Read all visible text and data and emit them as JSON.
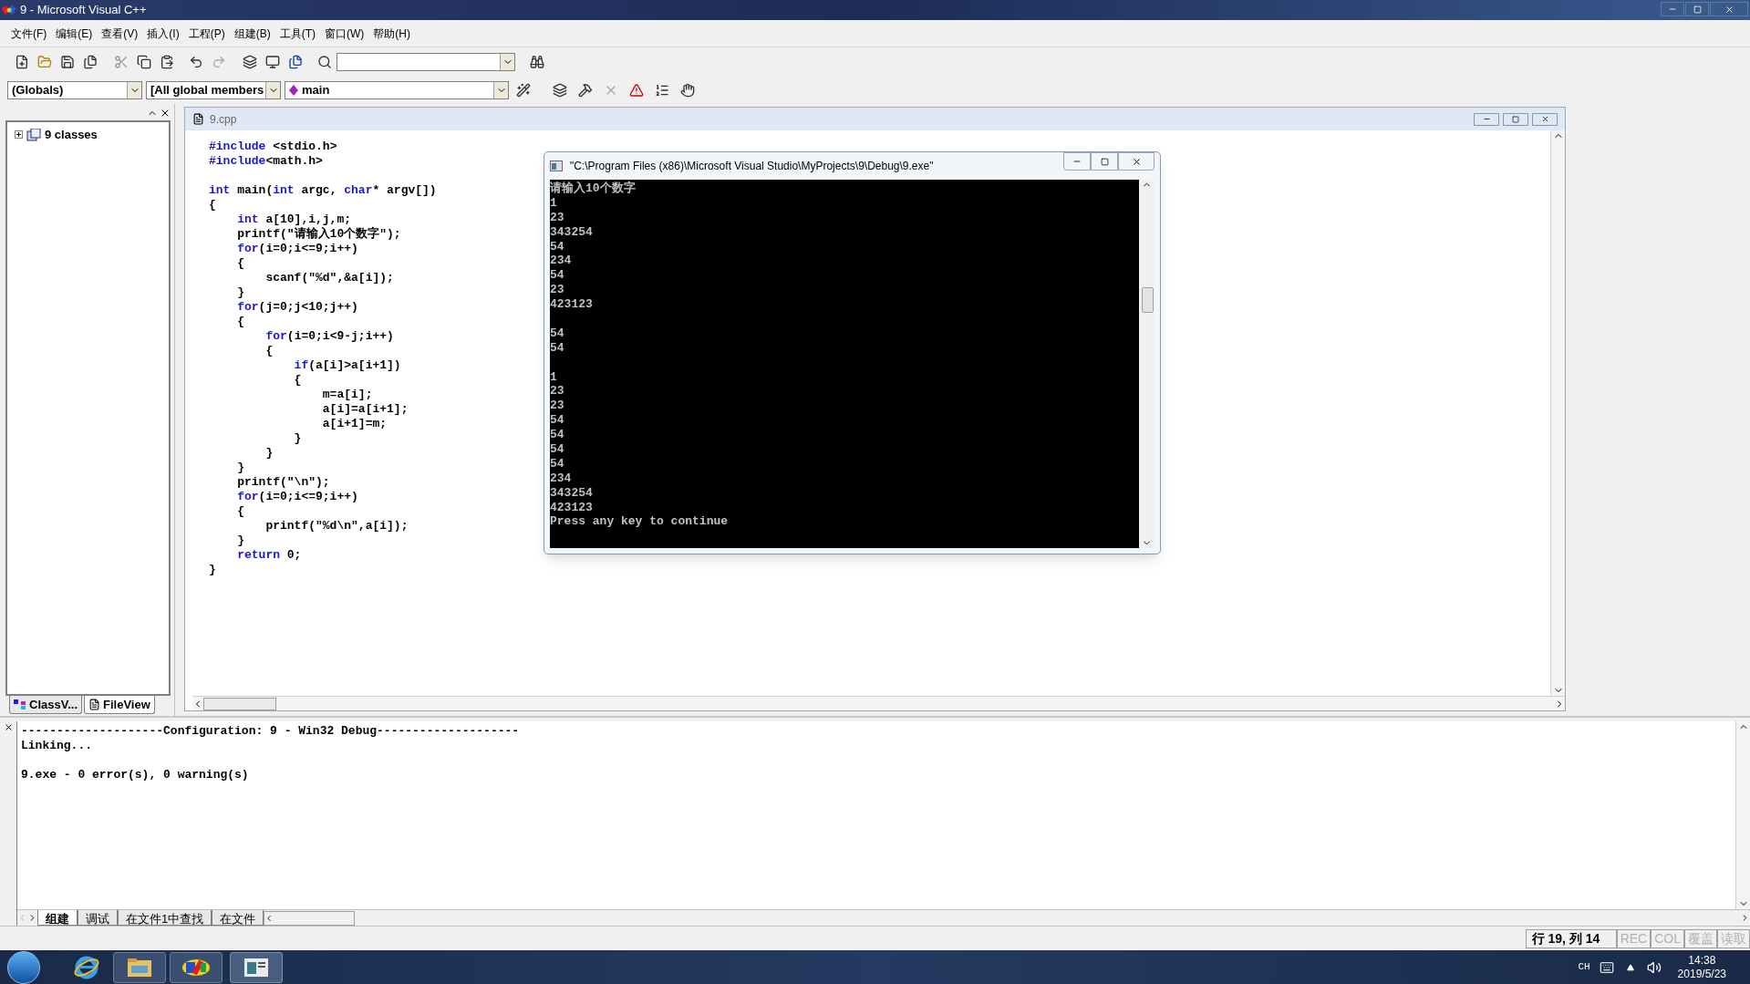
{
  "window": {
    "title": "9 - Microsoft Visual C++"
  },
  "menu": [
    {
      "label": "文件(F)"
    },
    {
      "label": "编辑(E)"
    },
    {
      "label": "查看(V)"
    },
    {
      "label": "插入(I)"
    },
    {
      "label": "工程(P)"
    },
    {
      "label": "组建(B)"
    },
    {
      "label": "工具(T)"
    },
    {
      "label": "窗口(W)"
    },
    {
      "label": "帮助(H)"
    }
  ],
  "wizard_bar": {
    "class": "(Globals)",
    "filter": "[All global members",
    "member": "main"
  },
  "workspace": {
    "tree": [
      {
        "label": "9 classes",
        "expanded": false
      }
    ],
    "tabs": [
      {
        "label": "ClassV...",
        "selected": false
      },
      {
        "label": "FileView",
        "selected": true
      }
    ]
  },
  "editor": {
    "title": "9.cpp",
    "lines": [
      {
        "kind": "code",
        "segments": [
          {
            "kind": "keyword",
            "text": "#include"
          },
          {
            "kind": "plain",
            "text": " <stdio.h>"
          }
        ]
      },
      {
        "kind": "code",
        "segments": [
          {
            "kind": "keyword",
            "text": "#include"
          },
          {
            "kind": "plain",
            "text": "<math.h>"
          }
        ]
      },
      {
        "kind": "blank"
      },
      {
        "kind": "code",
        "segments": [
          {
            "kind": "keyword",
            "text": "int"
          },
          {
            "kind": "plain",
            "text": " main("
          },
          {
            "kind": "keyword",
            "text": "int"
          },
          {
            "kind": "plain",
            "text": " argc, "
          },
          {
            "kind": "keyword",
            "text": "char"
          },
          {
            "kind": "plain",
            "text": "* argv[])"
          }
        ]
      },
      {
        "kind": "code",
        "segments": [
          {
            "kind": "plain",
            "text": "{"
          }
        ]
      },
      {
        "kind": "code",
        "segments": [
          {
            "kind": "keyword",
            "text": "    int"
          },
          {
            "kind": "plain",
            "text": " a[10],i,j,m;"
          }
        ]
      },
      {
        "kind": "code",
        "segments": [
          {
            "kind": "plain",
            "text": "    printf(\"请输入10个数字\");"
          }
        ]
      },
      {
        "kind": "code",
        "segments": [
          {
            "kind": "keyword",
            "text": "    for"
          },
          {
            "kind": "plain",
            "text": "(i=0;i<=9;i++)"
          }
        ]
      },
      {
        "kind": "code",
        "segments": [
          {
            "kind": "plain",
            "text": "    {"
          }
        ]
      },
      {
        "kind": "code",
        "segments": [
          {
            "kind": "plain",
            "text": "        scanf(\"%d\",&a[i]);"
          }
        ]
      },
      {
        "kind": "code",
        "segments": [
          {
            "kind": "plain",
            "text": "    }"
          }
        ]
      },
      {
        "kind": "code",
        "segments": [
          {
            "kind": "keyword",
            "text": "    for"
          },
          {
            "kind": "plain",
            "text": "(j=0;j<10;j++)"
          }
        ]
      },
      {
        "kind": "code",
        "segments": [
          {
            "kind": "plain",
            "text": "    {"
          }
        ]
      },
      {
        "kind": "code",
        "segments": [
          {
            "kind": "keyword",
            "text": "        for"
          },
          {
            "kind": "plain",
            "text": "(i=0;i<9-j;i++)"
          }
        ]
      },
      {
        "kind": "code",
        "segments": [
          {
            "kind": "plain",
            "text": "        {"
          }
        ]
      },
      {
        "kind": "code",
        "segments": [
          {
            "kind": "keyword",
            "text": "            if"
          },
          {
            "kind": "plain",
            "text": "(a[i]>a[i+1])"
          }
        ]
      },
      {
        "kind": "code",
        "segments": [
          {
            "kind": "plain",
            "text": "            {"
          }
        ]
      },
      {
        "kind": "code",
        "segments": [
          {
            "kind": "plain",
            "text": "                m=a[i];"
          }
        ]
      },
      {
        "kind": "code",
        "segments": [
          {
            "kind": "plain",
            "text": "                a[i]=a[i+1];"
          }
        ]
      },
      {
        "kind": "code",
        "segments": [
          {
            "kind": "plain",
            "text": "                a[i+1]=m;"
          }
        ]
      },
      {
        "kind": "code",
        "segments": [
          {
            "kind": "plain",
            "text": "            }"
          }
        ]
      },
      {
        "kind": "code",
        "segments": [
          {
            "kind": "plain",
            "text": "        }"
          }
        ]
      },
      {
        "kind": "code",
        "segments": [
          {
            "kind": "plain",
            "text": "    }"
          }
        ]
      },
      {
        "kind": "code",
        "segments": [
          {
            "kind": "plain",
            "text": "    printf(\"\\n\");"
          }
        ]
      },
      {
        "kind": "code",
        "segments": [
          {
            "kind": "keyword",
            "text": "    for"
          },
          {
            "kind": "plain",
            "text": "(i=0;i<=9;i++)"
          }
        ]
      },
      {
        "kind": "code",
        "segments": [
          {
            "kind": "plain",
            "text": "    {"
          }
        ]
      },
      {
        "kind": "code",
        "segments": [
          {
            "kind": "plain",
            "text": "        printf(\"%d\\n\",a[i]);"
          }
        ]
      },
      {
        "kind": "code",
        "segments": [
          {
            "kind": "plain",
            "text": "    }"
          }
        ]
      },
      {
        "kind": "code",
        "segments": [
          {
            "kind": "keyword",
            "text": "    return"
          },
          {
            "kind": "plain",
            "text": " 0;"
          }
        ]
      },
      {
        "kind": "code",
        "segments": [
          {
            "kind": "plain",
            "text": "}"
          }
        ]
      }
    ]
  },
  "console": {
    "title": "\"C:\\Program Files (x86)\\Microsoft Visual Studio\\MyProjects\\9\\Debug\\9.exe\"",
    "lines": [
      {
        "kind": "text",
        "text": "请输入10个数字"
      },
      {
        "kind": "text",
        "text": "1"
      },
      {
        "kind": "text",
        "text": "23"
      },
      {
        "kind": "text",
        "text": "343254"
      },
      {
        "kind": "text",
        "text": "54"
      },
      {
        "kind": "text",
        "text": "234"
      },
      {
        "kind": "text",
        "text": "54"
      },
      {
        "kind": "text",
        "text": "23"
      },
      {
        "kind": "text",
        "text": "423123"
      },
      {
        "kind": "blank"
      },
      {
        "kind": "text",
        "text": "54"
      },
      {
        "kind": "text",
        "text": "54"
      },
      {
        "kind": "blank"
      },
      {
        "kind": "text",
        "text": "1"
      },
      {
        "kind": "text",
        "text": "23"
      },
      {
        "kind": "text",
        "text": "23"
      },
      {
        "kind": "text",
        "text": "54"
      },
      {
        "kind": "text",
        "text": "54"
      },
      {
        "kind": "text",
        "text": "54"
      },
      {
        "kind": "text",
        "text": "54"
      },
      {
        "kind": "text",
        "text": "234"
      },
      {
        "kind": "text",
        "text": "343254"
      },
      {
        "kind": "text",
        "text": "423123"
      },
      {
        "kind": "text",
        "text": "Press any key to continue"
      }
    ]
  },
  "output": {
    "lines": [
      {
        "kind": "text",
        "text": "--------------------Configuration: 9 - Win32 Debug--------------------"
      },
      {
        "kind": "text",
        "text": "Linking..."
      },
      {
        "kind": "blank"
      },
      {
        "kind": "text",
        "text": "9.exe - 0 error(s), 0 warning(s)"
      }
    ],
    "tabs": [
      {
        "label": "组建",
        "selected": true
      },
      {
        "label": "调试",
        "selected": false
      },
      {
        "label": "在文件1中查找",
        "selected": false
      },
      {
        "label": "在文件",
        "selected": false
      }
    ]
  },
  "status_bar": {
    "position": "行 19, 列 14",
    "indicators": [
      {
        "label": "REC",
        "disabled": true
      },
      {
        "label": "COL",
        "disabled": true
      },
      {
        "label": "覆盖",
        "disabled": true
      },
      {
        "label": "读取",
        "disabled": true
      }
    ]
  },
  "taskbar": {
    "language": "CH",
    "time": "14:38",
    "date": "2019/5/23"
  }
}
